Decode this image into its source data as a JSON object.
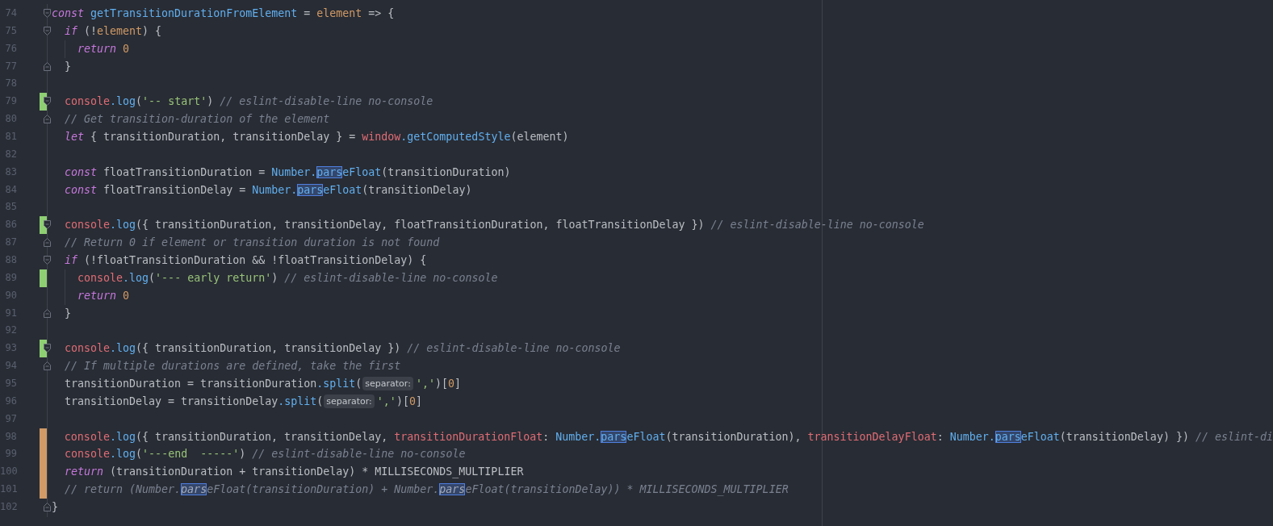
{
  "lines": [
    {
      "number": "74",
      "added": false,
      "modified": false,
      "fold_open": true,
      "fold_close": false,
      "indent_guide": false,
      "tokens": [
        {
          "kind": "kw",
          "text": "const"
        },
        {
          "kind": "fn",
          "text": " getTransitionDurationFromElement"
        },
        {
          "kind": "plain",
          "text": " = "
        },
        {
          "kind": "param",
          "text": "element"
        },
        {
          "kind": "plain",
          "text": " => {"
        }
      ]
    },
    {
      "number": "75",
      "added": false,
      "modified": false,
      "fold_open": true,
      "fold_close": false,
      "indent_guide": false,
      "tokens": [
        {
          "kind": "kw",
          "text": "  if"
        },
        {
          "kind": "plain",
          "text": " (!"
        },
        {
          "kind": "param",
          "text": "element"
        },
        {
          "kind": "plain",
          "text": ") {"
        }
      ]
    },
    {
      "number": "76",
      "added": false,
      "modified": false,
      "fold_open": false,
      "fold_close": false,
      "indent_guide": true,
      "tokens": [
        {
          "kind": "kw",
          "text": "    return"
        },
        {
          "kind": "num",
          "text": " 0"
        }
      ]
    },
    {
      "number": "77",
      "added": false,
      "modified": false,
      "fold_open": false,
      "fold_close": true,
      "indent_guide": false,
      "tokens": [
        {
          "kind": "plain",
          "text": "  }"
        }
      ]
    },
    {
      "number": "78",
      "added": false,
      "modified": false,
      "fold_open": false,
      "fold_close": false,
      "indent_guide": false
    },
    {
      "number": "79",
      "added": true,
      "modified": false,
      "fold_open": true,
      "fold_close": false,
      "indent_guide": false,
      "tokens": [
        {
          "kind": "red",
          "text": "  console"
        },
        {
          "kind": "fn",
          "text": ".log"
        },
        {
          "kind": "plain",
          "text": "("
        },
        {
          "kind": "str",
          "text": "'-- start'"
        },
        {
          "kind": "plain",
          "text": ") "
        },
        {
          "kind": "comment",
          "text": "// eslint-disable-line no-console"
        }
      ]
    },
    {
      "number": "80",
      "added": false,
      "modified": false,
      "fold_open": false,
      "fold_close": true,
      "indent_guide": false,
      "tokens": [
        {
          "kind": "comment",
          "text": "  // Get transition-duration of the element"
        }
      ]
    },
    {
      "number": "81",
      "added": false,
      "modified": false,
      "fold_open": false,
      "fold_close": false,
      "indent_guide": false,
      "tokens": [
        {
          "kind": "kw",
          "text": "  let"
        },
        {
          "kind": "plain",
          "text": " { transitionDuration, transitionDelay } = "
        },
        {
          "kind": "red",
          "text": "window"
        },
        {
          "kind": "fn",
          "text": ".getComputedStyle"
        },
        {
          "kind": "plain",
          "text": "(element)"
        }
      ]
    },
    {
      "number": "82",
      "added": false,
      "modified": false,
      "fold_open": false,
      "fold_close": false,
      "indent_guide": false
    },
    {
      "number": "83",
      "added": false,
      "modified": false,
      "fold_open": false,
      "fold_close": false,
      "indent_guide": false,
      "tokens": [
        {
          "kind": "kw",
          "text": "  const"
        },
        {
          "kind": "plain",
          "text": " floatTransitionDuration = "
        },
        {
          "kind": "fn",
          "text": "Number."
        },
        {
          "kind": "fnmatch",
          "text": "pars"
        },
        {
          "kind": "fn",
          "text": "eFloat"
        },
        {
          "kind": "plain",
          "text": "(transitionDuration)"
        }
      ]
    },
    {
      "number": "84",
      "added": false,
      "modified": false,
      "fold_open": false,
      "fold_close": false,
      "indent_guide": false,
      "tokens": [
        {
          "kind": "kw",
          "text": "  const"
        },
        {
          "kind": "plain",
          "text": " floatTransitionDelay = "
        },
        {
          "kind": "fn",
          "text": "Number."
        },
        {
          "kind": "fnmatch",
          "text": "pars"
        },
        {
          "kind": "fn",
          "text": "eFloat"
        },
        {
          "kind": "plain",
          "text": "(transitionDelay)"
        }
      ]
    },
    {
      "number": "85",
      "added": false,
      "modified": false,
      "fold_open": false,
      "fold_close": false,
      "indent_guide": false
    },
    {
      "number": "86",
      "added": true,
      "modified": false,
      "fold_open": true,
      "fold_close": false,
      "indent_guide": false,
      "tokens": [
        {
          "kind": "red",
          "text": "  console"
        },
        {
          "kind": "fn",
          "text": ".log"
        },
        {
          "kind": "plain",
          "text": "({ transitionDuration, transitionDelay, floatTransitionDuration, floatTransitionDelay }) "
        },
        {
          "kind": "comment",
          "text": "// eslint-disable-line no-console"
        }
      ]
    },
    {
      "number": "87",
      "added": false,
      "modified": false,
      "fold_open": false,
      "fold_close": true,
      "indent_guide": false,
      "tokens": [
        {
          "kind": "comment",
          "text": "  // Return 0 if element or transition duration is not found"
        }
      ]
    },
    {
      "number": "88",
      "added": false,
      "modified": false,
      "fold_open": true,
      "fold_close": false,
      "indent_guide": false,
      "tokens": [
        {
          "kind": "kw",
          "text": "  if"
        },
        {
          "kind": "plain",
          "text": " (!floatTransitionDuration && !floatTransitionDelay) {"
        }
      ]
    },
    {
      "number": "89",
      "added": true,
      "modified": false,
      "fold_open": false,
      "fold_close": false,
      "indent_guide": true,
      "tokens": [
        {
          "kind": "red",
          "text": "    console"
        },
        {
          "kind": "fn",
          "text": ".log"
        },
        {
          "kind": "plain",
          "text": "("
        },
        {
          "kind": "str",
          "text": "'--- early return'"
        },
        {
          "kind": "plain",
          "text": ") "
        },
        {
          "kind": "comment",
          "text": "// eslint-disable-line no-console"
        }
      ]
    },
    {
      "number": "90",
      "added": false,
      "modified": false,
      "fold_open": false,
      "fold_close": false,
      "indent_guide": true,
      "tokens": [
        {
          "kind": "kw",
          "text": "    return"
        },
        {
          "kind": "num",
          "text": " 0"
        }
      ]
    },
    {
      "number": "91",
      "added": false,
      "modified": false,
      "fold_open": false,
      "fold_close": true,
      "indent_guide": false,
      "tokens": [
        {
          "kind": "plain",
          "text": "  }"
        }
      ]
    },
    {
      "number": "92",
      "added": false,
      "modified": false,
      "fold_open": false,
      "fold_close": false,
      "indent_guide": false
    },
    {
      "number": "93",
      "added": true,
      "modified": false,
      "fold_open": true,
      "fold_close": false,
      "indent_guide": false,
      "tokens": [
        {
          "kind": "red",
          "text": "  console"
        },
        {
          "kind": "fn",
          "text": ".log"
        },
        {
          "kind": "plain",
          "text": "({ transitionDuration, transitionDelay }) "
        },
        {
          "kind": "comment",
          "text": "// eslint-disable-line no-console"
        }
      ]
    },
    {
      "number": "94",
      "added": false,
      "modified": false,
      "fold_open": false,
      "fold_close": true,
      "indent_guide": false,
      "tokens": [
        {
          "kind": "comment",
          "text": "  // If multiple durations are defined, take the first"
        }
      ]
    },
    {
      "number": "95",
      "added": false,
      "modified": false,
      "fold_open": false,
      "fold_close": false,
      "indent_guide": false,
      "tokens": [
        {
          "kind": "plain",
          "text": "  transitionDuration = transitionDuration"
        },
        {
          "kind": "fn",
          "text": ".split"
        },
        {
          "kind": "plain",
          "text": "("
        },
        {
          "kind": "hint",
          "text": "separator:"
        },
        {
          "kind": "str",
          "text": "','"
        },
        {
          "kind": "plain",
          "text": ")["
        },
        {
          "kind": "num",
          "text": "0"
        },
        {
          "kind": "plain",
          "text": "]"
        }
      ]
    },
    {
      "number": "96",
      "added": false,
      "modified": false,
      "fold_open": false,
      "fold_close": false,
      "indent_guide": false,
      "tokens": [
        {
          "kind": "plain",
          "text": "  transitionDelay = transitionDelay"
        },
        {
          "kind": "fn",
          "text": ".split"
        },
        {
          "kind": "plain",
          "text": "("
        },
        {
          "kind": "hint",
          "text": "separator:"
        },
        {
          "kind": "str",
          "text": "','"
        },
        {
          "kind": "plain",
          "text": ")["
        },
        {
          "kind": "num",
          "text": "0"
        },
        {
          "kind": "plain",
          "text": "]"
        }
      ]
    },
    {
      "number": "97",
      "added": false,
      "modified": false,
      "fold_open": false,
      "fold_close": false,
      "indent_guide": false
    },
    {
      "number": "98",
      "added": false,
      "modified": true,
      "fold_open": false,
      "fold_close": false,
      "indent_guide": false,
      "tokens": [
        {
          "kind": "red",
          "text": "  console"
        },
        {
          "kind": "fn",
          "text": ".log"
        },
        {
          "kind": "plain",
          "text": "({ transitionDuration, transitionDelay, "
        },
        {
          "kind": "red",
          "text": "transitionDurationFloat"
        },
        {
          "kind": "plain",
          "text": ": "
        },
        {
          "kind": "fn",
          "text": "Number."
        },
        {
          "kind": "fnmatch",
          "text": "pars"
        },
        {
          "kind": "fn",
          "text": "eFloat"
        },
        {
          "kind": "plain",
          "text": "(transitionDuration), "
        },
        {
          "kind": "red",
          "text": "transitionDelayFloat"
        },
        {
          "kind": "plain",
          "text": ": "
        },
        {
          "kind": "fn",
          "text": "Number."
        },
        {
          "kind": "fnmatch",
          "text": "pars"
        },
        {
          "kind": "fn",
          "text": "eFloat"
        },
        {
          "kind": "plain",
          "text": "(transitionDelay) }) "
        },
        {
          "kind": "comment",
          "text": "// eslint-di"
        }
      ]
    },
    {
      "number": "99",
      "added": false,
      "modified": true,
      "fold_open": false,
      "fold_close": false,
      "indent_guide": false,
      "tokens": [
        {
          "kind": "red",
          "text": "  console"
        },
        {
          "kind": "fn",
          "text": ".log"
        },
        {
          "kind": "plain",
          "text": "("
        },
        {
          "kind": "str",
          "text": "'---end  -----'"
        },
        {
          "kind": "plain",
          "text": ") "
        },
        {
          "kind": "comment",
          "text": "// eslint-disable-line no-console"
        }
      ]
    },
    {
      "number": "100",
      "added": false,
      "modified": true,
      "fold_open": false,
      "fold_close": false,
      "indent_guide": false,
      "tokens": [
        {
          "kind": "kw",
          "text": "  return"
        },
        {
          "kind": "plain",
          "text": " (transitionDuration + transitionDelay) * MILLISECONDS_MULTIPLIER"
        }
      ]
    },
    {
      "number": "101",
      "added": false,
      "modified": true,
      "fold_open": false,
      "fold_close": false,
      "indent_guide": false,
      "tokens": [
        {
          "kind": "comment",
          "text": "  // return (Number."
        },
        {
          "kind": "commentmatch",
          "text": "pars"
        },
        {
          "kind": "comment",
          "text": "eFloat(transitionDuration) + Number."
        },
        {
          "kind": "commentmatch",
          "text": "pars"
        },
        {
          "kind": "comment",
          "text": "eFloat(transitionDelay)) * MILLISECONDS_MULTIPLIER"
        }
      ]
    },
    {
      "number": "102",
      "added": false,
      "modified": false,
      "fold_open": false,
      "fold_close": true,
      "indent_guide": false,
      "tokens": [
        {
          "kind": "plain",
          "text": "}"
        }
      ]
    }
  ]
}
